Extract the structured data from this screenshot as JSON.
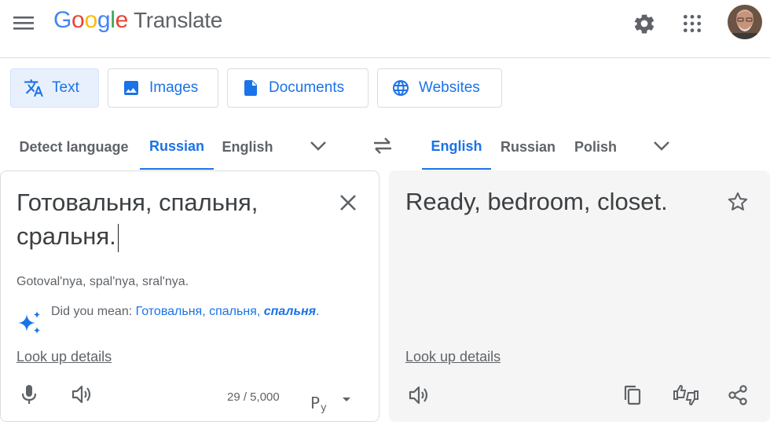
{
  "header": {
    "logo_letters": [
      "G",
      "o",
      "o",
      "g",
      "l",
      "e"
    ],
    "logo_colors": [
      "#4285f4",
      "#ea4335",
      "#fbbc05",
      "#4285f4",
      "#34a853",
      "#ea4335"
    ],
    "product": "Translate",
    "icons": [
      "menu-icon",
      "settings-icon",
      "apps-icon",
      "avatar"
    ]
  },
  "modes": [
    {
      "label": "Text",
      "icon": "translate-icon",
      "active": true
    },
    {
      "label": "Images",
      "icon": "image-icon",
      "active": false
    },
    {
      "label": "Documents",
      "icon": "document-icon",
      "active": false
    },
    {
      "label": "Websites",
      "icon": "globe-icon",
      "active": false
    }
  ],
  "source_langs": {
    "tabs": [
      "Detect language",
      "Russian",
      "English"
    ],
    "active": "Russian"
  },
  "target_langs": {
    "tabs": [
      "English",
      "Russian",
      "Polish"
    ],
    "active": "English"
  },
  "source": {
    "text": "Готовальня, спальня, сральня.",
    "transliteration": "Gotoval'nya, spal'nya, sral'nya.",
    "did_you_mean_label": "Did you mean:",
    "suggestion_plain": "Готовальня, спальня,",
    "suggestion_emph": "спальня",
    "suggestion_end": ".",
    "lookup": "Look up details",
    "char_count": "29 / 5,000"
  },
  "target": {
    "text": "Ready, bedroom, closet.",
    "lookup": "Look up details"
  },
  "colors": {
    "accent": "#1a73e8",
    "active_tab_bg": "#e8f0fe",
    "target_panel_bg": "#f5f5f5"
  }
}
